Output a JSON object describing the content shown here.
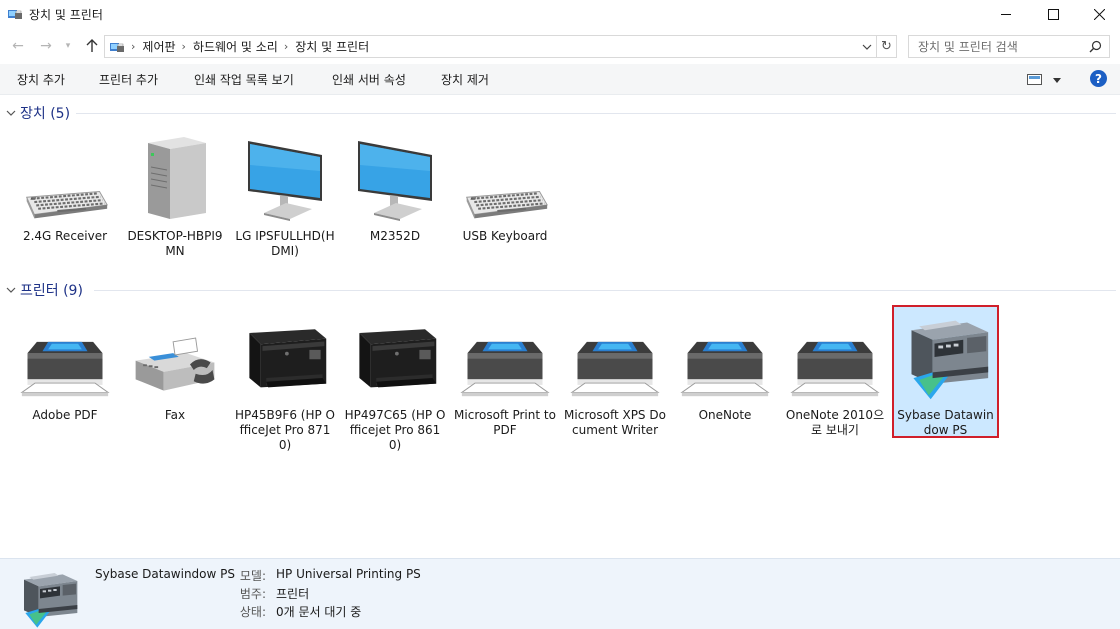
{
  "window": {
    "title": "장치 및 프린터"
  },
  "address": {
    "crumbs": [
      "제어판",
      "하드웨어 및 소리",
      "장치 및 프린터"
    ]
  },
  "search": {
    "placeholder": "장치 및 프린터 검색"
  },
  "commands": [
    "장치 추가",
    "프린터 추가",
    "인쇄 작업 목록 보기",
    "인쇄 서버 속성",
    "장치 제거"
  ],
  "help_label": "?",
  "groups": {
    "devices": {
      "title": "장치 (5)",
      "items": [
        {
          "label": "2.4G Receiver",
          "icon": "keyboard-icon"
        },
        {
          "label": "DESKTOP-HBPI9MN",
          "icon": "computer-tower-icon"
        },
        {
          "label": "LG IPSFULLHD(HDMI)",
          "icon": "monitor-icon"
        },
        {
          "label": "M2352D",
          "icon": "monitor-icon"
        },
        {
          "label": "USB Keyboard",
          "icon": "keyboard-icon"
        }
      ]
    },
    "printers": {
      "title": "프린터 (9)",
      "items": [
        {
          "label": "Adobe PDF",
          "icon": "printer-icon"
        },
        {
          "label": "Fax",
          "icon": "fax-icon"
        },
        {
          "label": "HP45B9F6 (HP OfficeJet Pro 8710)",
          "icon": "officejet-printer-icon"
        },
        {
          "label": "HP497C65 (HP Officejet Pro 8610)",
          "icon": "officejet-printer-icon"
        },
        {
          "label": "Microsoft Print to PDF",
          "icon": "printer-icon"
        },
        {
          "label": "Microsoft XPS Document Writer",
          "icon": "printer-icon"
        },
        {
          "label": "OneNote",
          "icon": "printer-icon"
        },
        {
          "label": "OneNote 2010으로 보내기",
          "icon": "printer-icon"
        },
        {
          "label": "Sybase Datawindow PS",
          "icon": "mfp-printer-icon",
          "selected": true
        }
      ]
    }
  },
  "details": {
    "name": "Sybase Datawindow PS",
    "rows": [
      {
        "key": "모델:",
        "value": "HP Universal Printing PS"
      },
      {
        "key": "범주:",
        "value": "프린터"
      },
      {
        "key": "상태:",
        "value": "0개 문서 대기 중"
      }
    ]
  },
  "colors": {
    "group_title": "#1e3287",
    "selection_fill": "#cce8ff",
    "selection_border": "#d01f2a",
    "details_bg": "#eef4fb",
    "help_blue": "#1c5fc4"
  }
}
